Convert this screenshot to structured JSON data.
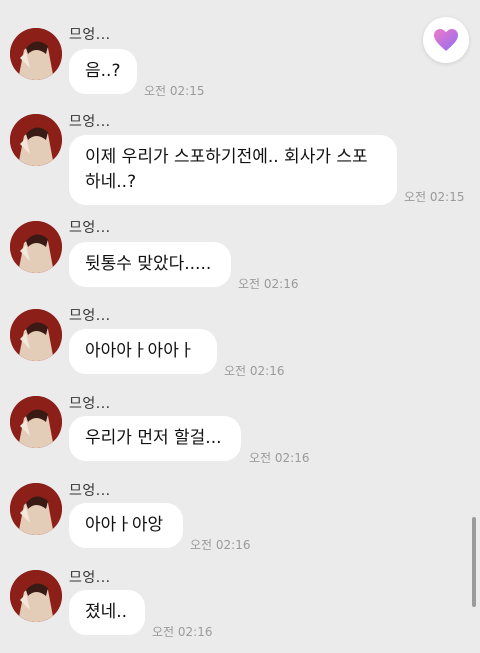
{
  "messages": [
    {
      "sender": "므엉...",
      "text": "음..?",
      "time": "오전 02:15"
    },
    {
      "sender": "므엉...",
      "text": "이제 우리가 스포하기전에.. 회사가 스포\n하네..?",
      "time": "오전 02:15"
    },
    {
      "sender": "므엉...",
      "text": "뒷통수 맞았다.....",
      "time": "오전 02:16"
    },
    {
      "sender": "므엉...",
      "text": "아아아ㅏ아아ㅏ",
      "time": "오전 02:16"
    },
    {
      "sender": "므엉...",
      "text": "우리가 먼저 할걸...",
      "time": "오전 02:16"
    },
    {
      "sender": "므엉...",
      "text": "아아ㅏ아앙",
      "time": "오전 02:16"
    },
    {
      "sender": "므엉...",
      "text": "졌네..",
      "time": "오전 02:16"
    }
  ],
  "icons": {
    "heart_button": "heart-icon",
    "avatar": "profile-avatar"
  },
  "colors": {
    "background": "#ebebeb",
    "bubble": "#ffffff",
    "heart_gradient_start": "#f07ac8",
    "heart_gradient_end": "#8e6cf0"
  }
}
